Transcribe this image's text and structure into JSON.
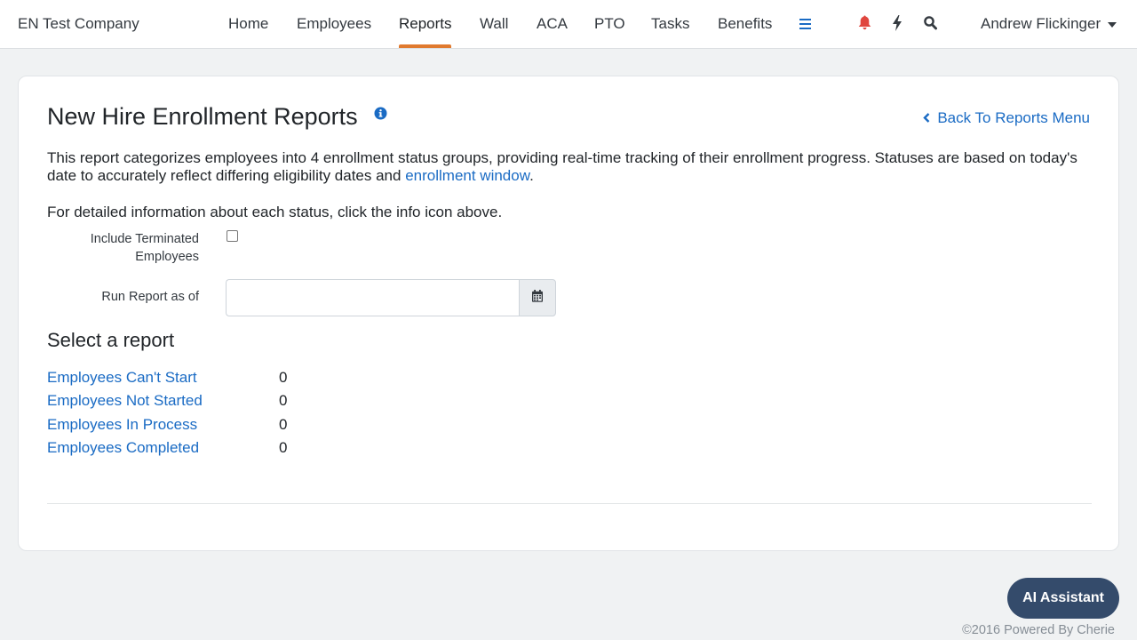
{
  "header": {
    "company": "EN Test Company",
    "nav": [
      {
        "label": "Home"
      },
      {
        "label": "Employees"
      },
      {
        "label": "Reports"
      },
      {
        "label": "Wall"
      },
      {
        "label": "ACA"
      },
      {
        "label": "PTO"
      },
      {
        "label": "Tasks"
      },
      {
        "label": "Benefits"
      }
    ],
    "active_nav": "Reports",
    "user_name": "Andrew Flickinger",
    "icons": [
      "hamburger-menu-icon",
      "bell-icon",
      "bolt-icon",
      "search-icon"
    ],
    "colors": {
      "active_underline": "#e07a2f",
      "bell": "#e0463e",
      "menu": "#1a6bc4"
    }
  },
  "page": {
    "title": "New Hire Enrollment Reports",
    "back_link": "Back To Reports Menu",
    "description_before": "This report categorizes employees into 4 enrollment status groups, providing real-time tracking of their enrollment progress. Statuses are based on today's date to accurately reflect differing eligibility dates and ",
    "description_link": "enrollment window",
    "description_after": ".",
    "description2": "For detailed information about each status, click the info icon above.",
    "include_terminated_label": "Include Terminated Employees",
    "include_terminated_checked": false,
    "run_as_of_label": "Run Report as of",
    "run_as_of_value": "",
    "select_heading": "Select a report",
    "reports": [
      {
        "label": "Employees Can't Start",
        "count": "0"
      },
      {
        "label": "Employees Not Started",
        "count": "0"
      },
      {
        "label": "Employees In Process",
        "count": "0"
      },
      {
        "label": "Employees Completed",
        "count": "0"
      }
    ]
  },
  "ai_button": "AI Assistant",
  "footer": "©2016 Powered By Cherie",
  "link_color": "#1a6bc4"
}
